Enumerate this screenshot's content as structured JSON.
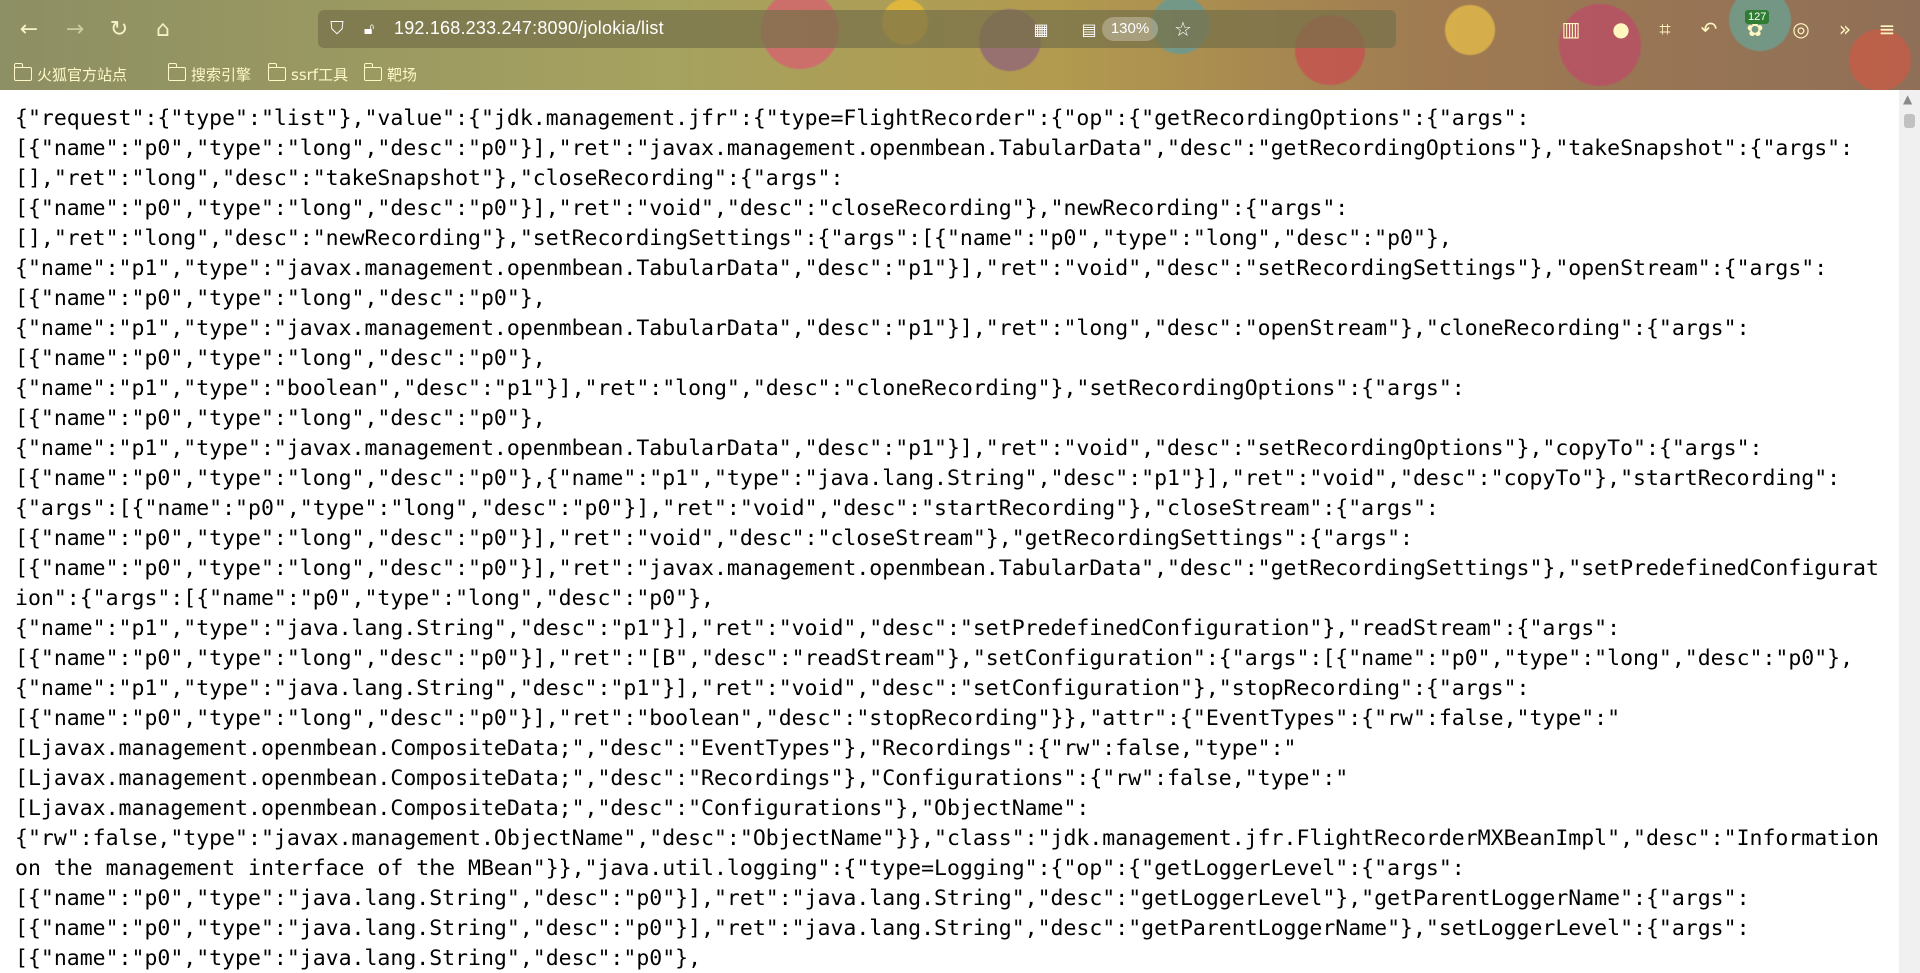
{
  "browser": {
    "url": "192.168.233.247:8090/jolokia/list",
    "zoom": "130%",
    "extension_badge": "127",
    "toolbar_icons": [
      "back-arrow-icon",
      "forward-arrow-icon",
      "reload-icon",
      "home-icon"
    ],
    "bookmarks": [
      "火狐官方站点",
      "搜索引擎",
      "ssrf工具",
      "靶场"
    ]
  },
  "content": {
    "lines": [
      "{\"request\":{\"type\":\"list\"},\"value\":{\"jdk.management.jfr\":{\"type=FlightRecorder\":{\"op\":{\"getRecordingOptions\":{\"args\":",
      "[{\"name\":\"p0\",\"type\":\"long\",\"desc\":\"p0\"}],\"ret\":\"javax.management.openmbean.TabularData\",\"desc\":\"getRecordingOptions\"},\"takeSnapshot\":{\"args\":",
      "[],\"ret\":\"long\",\"desc\":\"takeSnapshot\"},\"closeRecording\":{\"args\":",
      "[{\"name\":\"p0\",\"type\":\"long\",\"desc\":\"p0\"}],\"ret\":\"void\",\"desc\":\"closeRecording\"},\"newRecording\":{\"args\":",
      "[],\"ret\":\"long\",\"desc\":\"newRecording\"},\"setRecordingSettings\":{\"args\":[{\"name\":\"p0\",\"type\":\"long\",\"desc\":\"p0\"},",
      "{\"name\":\"p1\",\"type\":\"javax.management.openmbean.TabularData\",\"desc\":\"p1\"}],\"ret\":\"void\",\"desc\":\"setRecordingSettings\"},\"openStream\":{\"args\":",
      "[{\"name\":\"p0\",\"type\":\"long\",\"desc\":\"p0\"},",
      "{\"name\":\"p1\",\"type\":\"javax.management.openmbean.TabularData\",\"desc\":\"p1\"}],\"ret\":\"long\",\"desc\":\"openStream\"},\"cloneRecording\":{\"args\":",
      "[{\"name\":\"p0\",\"type\":\"long\",\"desc\":\"p0\"},",
      "{\"name\":\"p1\",\"type\":\"boolean\",\"desc\":\"p1\"}],\"ret\":\"long\",\"desc\":\"cloneRecording\"},\"setRecordingOptions\":{\"args\":",
      "[{\"name\":\"p0\",\"type\":\"long\",\"desc\":\"p0\"},",
      "{\"name\":\"p1\",\"type\":\"javax.management.openmbean.TabularData\",\"desc\":\"p1\"}],\"ret\":\"void\",\"desc\":\"setRecordingOptions\"},\"copyTo\":{\"args\":",
      "[{\"name\":\"p0\",\"type\":\"long\",\"desc\":\"p0\"},{\"name\":\"p1\",\"type\":\"java.lang.String\",\"desc\":\"p1\"}],\"ret\":\"void\",\"desc\":\"copyTo\"},\"startRecording\":",
      "{\"args\":[{\"name\":\"p0\",\"type\":\"long\",\"desc\":\"p0\"}],\"ret\":\"void\",\"desc\":\"startRecording\"},\"closeStream\":{\"args\":",
      "[{\"name\":\"p0\",\"type\":\"long\",\"desc\":\"p0\"}],\"ret\":\"void\",\"desc\":\"closeStream\"},\"getRecordingSettings\":{\"args\":",
      "[{\"name\":\"p0\",\"type\":\"long\",\"desc\":\"p0\"}],\"ret\":\"javax.management.openmbean.TabularData\",\"desc\":\"getRecordingSettings\"},\"setPredefinedConfigurat",
      "ion\":{\"args\":[{\"name\":\"p0\",\"type\":\"long\",\"desc\":\"p0\"},",
      "{\"name\":\"p1\",\"type\":\"java.lang.String\",\"desc\":\"p1\"}],\"ret\":\"void\",\"desc\":\"setPredefinedConfiguration\"},\"readStream\":{\"args\":",
      "[{\"name\":\"p0\",\"type\":\"long\",\"desc\":\"p0\"}],\"ret\":\"[B\",\"desc\":\"readStream\"},\"setConfiguration\":{\"args\":[{\"name\":\"p0\",\"type\":\"long\",\"desc\":\"p0\"},",
      "{\"name\":\"p1\",\"type\":\"java.lang.String\",\"desc\":\"p1\"}],\"ret\":\"void\",\"desc\":\"setConfiguration\"},\"stopRecording\":{\"args\":",
      "[{\"name\":\"p0\",\"type\":\"long\",\"desc\":\"p0\"}],\"ret\":\"boolean\",\"desc\":\"stopRecording\"}},\"attr\":{\"EventTypes\":{\"rw\":false,\"type\":\"",
      "[Ljavax.management.openmbean.CompositeData;\",\"desc\":\"EventTypes\"},\"Recordings\":{\"rw\":false,\"type\":\"",
      "[Ljavax.management.openmbean.CompositeData;\",\"desc\":\"Recordings\"},\"Configurations\":{\"rw\":false,\"type\":\"",
      "[Ljavax.management.openmbean.CompositeData;\",\"desc\":\"Configurations\"},\"ObjectName\":",
      "{\"rw\":false,\"type\":\"javax.management.ObjectName\",\"desc\":\"ObjectName\"}},\"class\":\"jdk.management.jfr.FlightRecorderMXBeanImpl\",\"desc\":\"Information",
      "on the management interface of the MBean\"}},\"java.util.logging\":{\"type=Logging\":{\"op\":{\"getLoggerLevel\":{\"args\":",
      "[{\"name\":\"p0\",\"type\":\"java.lang.String\",\"desc\":\"p0\"}],\"ret\":\"java.lang.String\",\"desc\":\"getLoggerLevel\"},\"getParentLoggerName\":{\"args\":",
      "[{\"name\":\"p0\",\"type\":\"java.lang.String\",\"desc\":\"p0\"}],\"ret\":\"java.lang.String\",\"desc\":\"getParentLoggerName\"},\"setLoggerLevel\":{\"args\":",
      "[{\"name\":\"p0\",\"type\":\"java.lang.String\",\"desc\":\"p0\"},"
    ]
  }
}
